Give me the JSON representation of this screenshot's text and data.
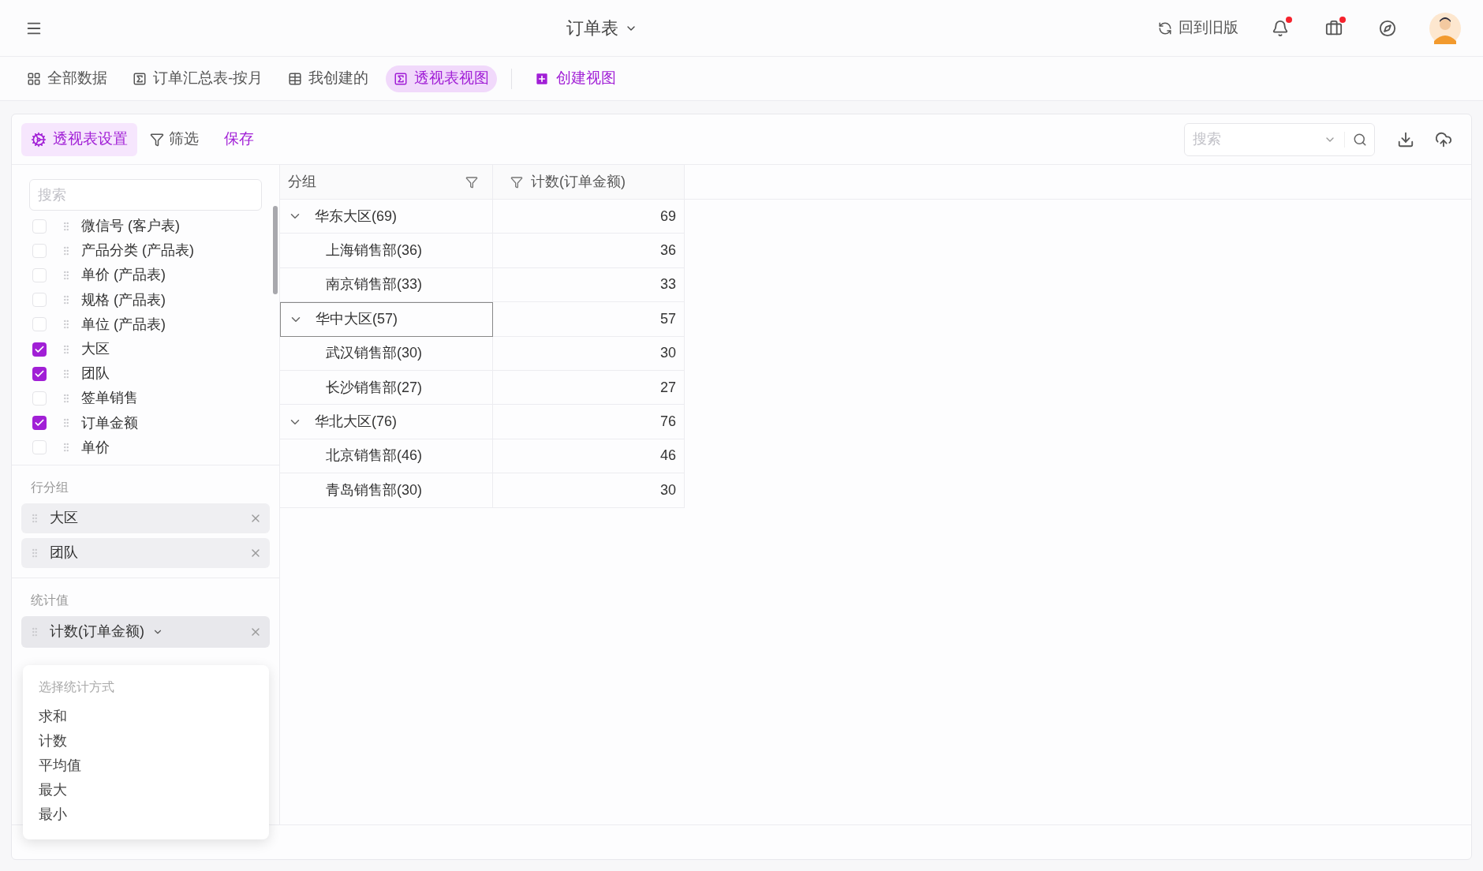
{
  "header": {
    "title": "订单表",
    "old_version": "回到旧版",
    "notifications": {
      "unread": true
    },
    "messages": {
      "unread": true
    }
  },
  "views": [
    {
      "label": "全部数据",
      "kind": "grid",
      "selected": false
    },
    {
      "label": "订单汇总表-按月",
      "kind": "pivot",
      "selected": false
    },
    {
      "label": "我创建的",
      "kind": "table",
      "selected": false
    },
    {
      "label": "透视表视图",
      "kind": "pivot",
      "selected": true
    }
  ],
  "create_view": "创建视图",
  "toolbar": {
    "settings": {
      "label": "透视表设置",
      "selected": true
    },
    "filter": "筛选",
    "save": "保存",
    "search": {
      "placeholder": "搜索"
    }
  },
  "fields": {
    "search": {
      "placeholder": "搜索"
    },
    "items": [
      {
        "label": "微信号 (客户表)",
        "checked": false
      },
      {
        "label": "产品分类 (产品表)",
        "checked": false
      },
      {
        "label": "单价 (产品表)",
        "checked": false
      },
      {
        "label": "规格 (产品表)",
        "checked": false
      },
      {
        "label": "单位 (产品表)",
        "checked": false
      },
      {
        "label": "大区",
        "checked": true
      },
      {
        "label": "团队",
        "checked": true
      },
      {
        "label": "签单销售",
        "checked": false
      },
      {
        "label": "订单金额",
        "checked": true
      },
      {
        "label": "单价",
        "checked": false
      }
    ]
  },
  "row_groups": {
    "title": "行分组",
    "items": [
      "大区",
      "团队"
    ]
  },
  "values": {
    "title": "统计值",
    "items": [
      "计数(订单金额)"
    ]
  },
  "aggregate_menu": {
    "title": "选择统计方式",
    "options": [
      "求和",
      "计数",
      "平均值",
      "最大",
      "最小"
    ]
  },
  "table": {
    "columns": [
      "分组",
      "计数(订单金额)"
    ],
    "rows": [
      {
        "label": "华东大区(69)",
        "value": "69",
        "expanded": true,
        "selected": false,
        "children": [
          {
            "label": "上海销售部(36)",
            "value": "36"
          },
          {
            "label": "南京销售部(33)",
            "value": "33"
          }
        ]
      },
      {
        "label": "华中大区(57)",
        "value": "57",
        "expanded": true,
        "selected": true,
        "children": [
          {
            "label": "武汉销售部(30)",
            "value": "30"
          },
          {
            "label": "长沙销售部(27)",
            "value": "27"
          }
        ]
      },
      {
        "label": "华北大区(76)",
        "value": "76",
        "expanded": true,
        "selected": false,
        "children": [
          {
            "label": "北京销售部(46)",
            "value": "46"
          },
          {
            "label": "青岛销售部(30)",
            "value": "30"
          }
        ]
      }
    ]
  }
}
